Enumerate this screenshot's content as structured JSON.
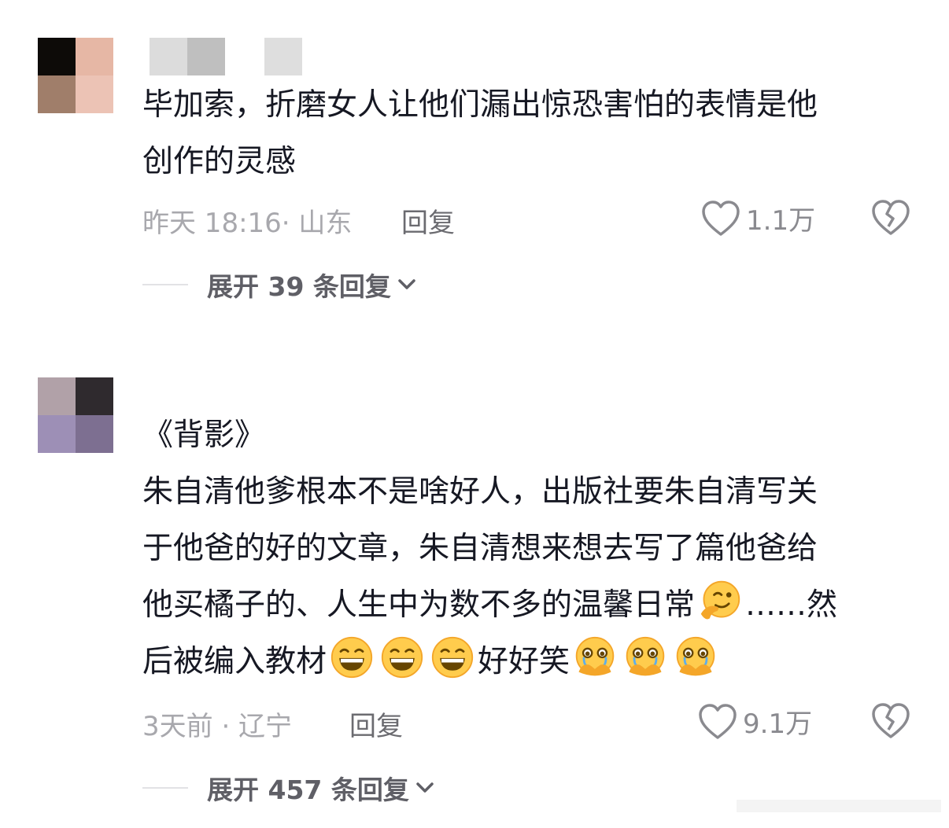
{
  "comments": [
    {
      "text_lines": [
        "毕加索，折磨女人让他们漏出惊恐害怕的表情是他",
        "创作的灵感"
      ],
      "time_location": "昨天 18:16· 山东",
      "reply_label": "回复",
      "like_count": "1.1万",
      "expand_label": "展开 39 条回复"
    },
    {
      "title_line": "《背影》",
      "line1": "朱自清他爹根本不是啥好人，出版社要朱自清写关",
      "line2": "于他爸的好的文章，朱自清想来想去写了篇他爸给",
      "line3_a": "他买橘子的、人生中为数不多的温馨日常",
      "line3_b": "……然",
      "line4_a": "后被编入教材",
      "line4_b": "好好笑",
      "time_location": "3天前 · 辽宁",
      "reply_label": "回复",
      "like_count": "9.1万",
      "expand_label": "展开 457 条回复"
    }
  ],
  "icons": {
    "like": "heart-outline-icon",
    "dislike": "broken-heart-icon",
    "expand": "chevron-down-icon",
    "emoji_thinking": "smirk-face-emoji",
    "emoji_grin": "grinning-face-emoji",
    "emoji_cry": "holding-back-tears-emoji"
  },
  "colors": {
    "text": "#161823",
    "meta": "#a8a8ad",
    "reply": "#6b6b70",
    "expand": "#5f5f66"
  }
}
